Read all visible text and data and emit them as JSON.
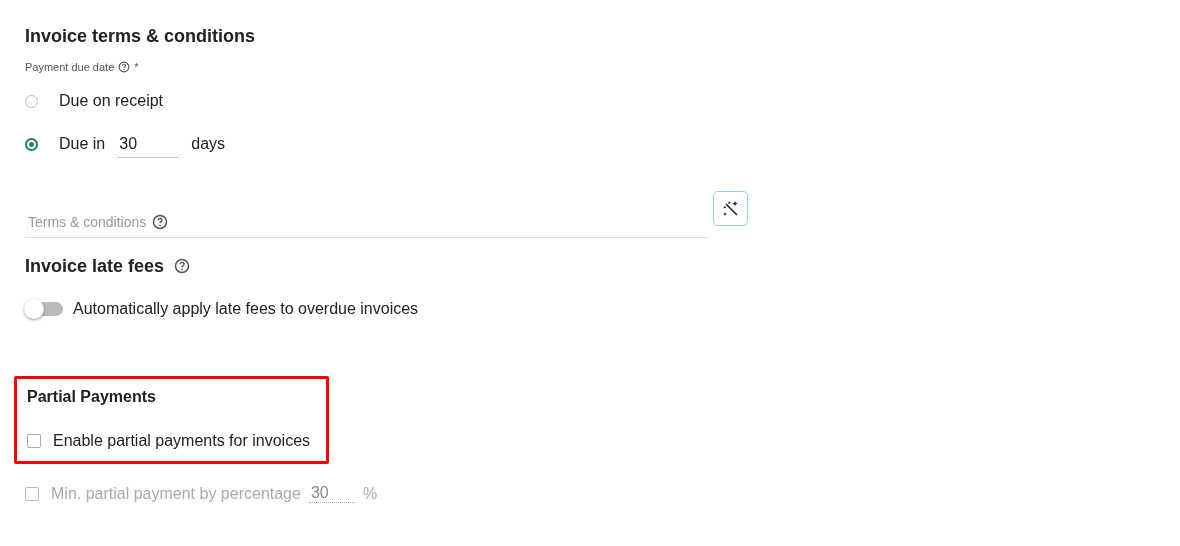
{
  "terms": {
    "title": "Invoice terms & conditions",
    "due_label": "Payment due date",
    "required_mark": "*",
    "options": [
      {
        "label": "Due on receipt",
        "selected": false
      },
      {
        "label": "Due in",
        "selected": true,
        "value": "30",
        "suffix": "days"
      }
    ],
    "conditions": {
      "placeholder": "Terms & conditions"
    }
  },
  "late_fees": {
    "title": "Invoice late fees",
    "toggle": {
      "label": "Automatically apply late fees to overdue invoices",
      "on": false
    }
  },
  "partial_payments": {
    "title": "Partial Payments",
    "highlighted": true,
    "enable": {
      "label": "Enable partial payments for invoices",
      "checked": false
    },
    "minimum": {
      "label": "Min. partial payment by percentage",
      "checked": false,
      "disabled": true,
      "value": "30",
      "suffix": "%"
    }
  }
}
